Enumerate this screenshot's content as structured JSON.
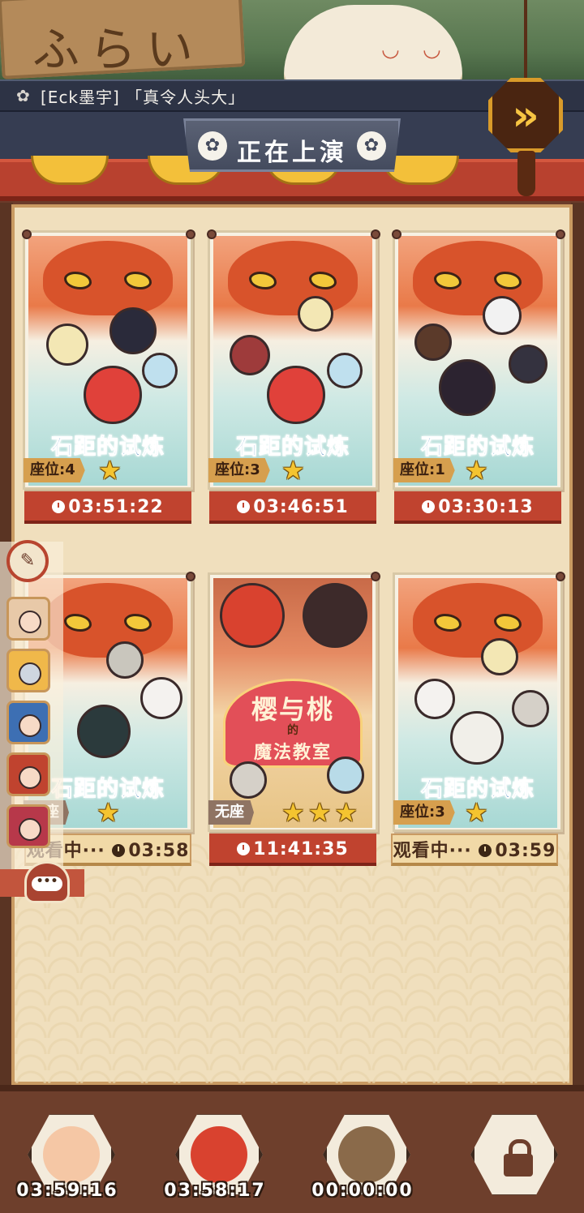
{
  "marquee": {
    "text": "[Eck墨宇] 「真令人头大」"
  },
  "header": {
    "title": "正在上演",
    "sign_text": "ふらい",
    "forward_icon": "double-chevron-right-icon"
  },
  "shows": [
    {
      "title": "石距的试炼",
      "seat": "座位:4",
      "stars": 1,
      "stars_text": "★",
      "timer": "03:51:22",
      "watching": false
    },
    {
      "title": "石距的试炼",
      "seat": "座位:3",
      "stars": 1,
      "stars_text": "★",
      "timer": "03:46:51",
      "watching": false
    },
    {
      "title": "石距的试炼",
      "seat": "座位:1",
      "stars": 1,
      "stars_text": "★",
      "timer": "03:30:13",
      "watching": false
    },
    {
      "title": "石距的试炼",
      "seat": "无座",
      "stars": 1,
      "stars_text": "★",
      "timer": "03:58",
      "watching": true,
      "watching_label": "观看中···"
    },
    {
      "title_line1": "樱与桃",
      "title_line2": "的",
      "title_line3": "魔法教室",
      "seat": "无座",
      "stars": 3,
      "stars_text": "★★★",
      "timer": "11:41:35",
      "watching": false
    },
    {
      "title": "石距的试炼",
      "seat": "座位:3",
      "stars": 1,
      "stars_text": "★",
      "timer": "03:59",
      "watching": true,
      "watching_label": "观看中···"
    }
  ],
  "bottom": {
    "slots": [
      {
        "timer": "03:59:16",
        "icon": "character-avatar-icon"
      },
      {
        "timer": "03:58:17",
        "icon": "oni-avatar-icon"
      },
      {
        "timer": "00:00:00",
        "icon": "hat-character-avatar-icon"
      },
      {
        "timer": "",
        "icon": "lock-icon"
      }
    ]
  },
  "side": {
    "tool_icon": "broom-icon",
    "chat_icon": "chat-icon",
    "chat_dots": "•••"
  },
  "colors": {
    "accent_red": "#c0432f",
    "panel_bg": "#f0dfbd",
    "title_blue": "#3d7fb8",
    "star_gold": "#f4c430"
  }
}
